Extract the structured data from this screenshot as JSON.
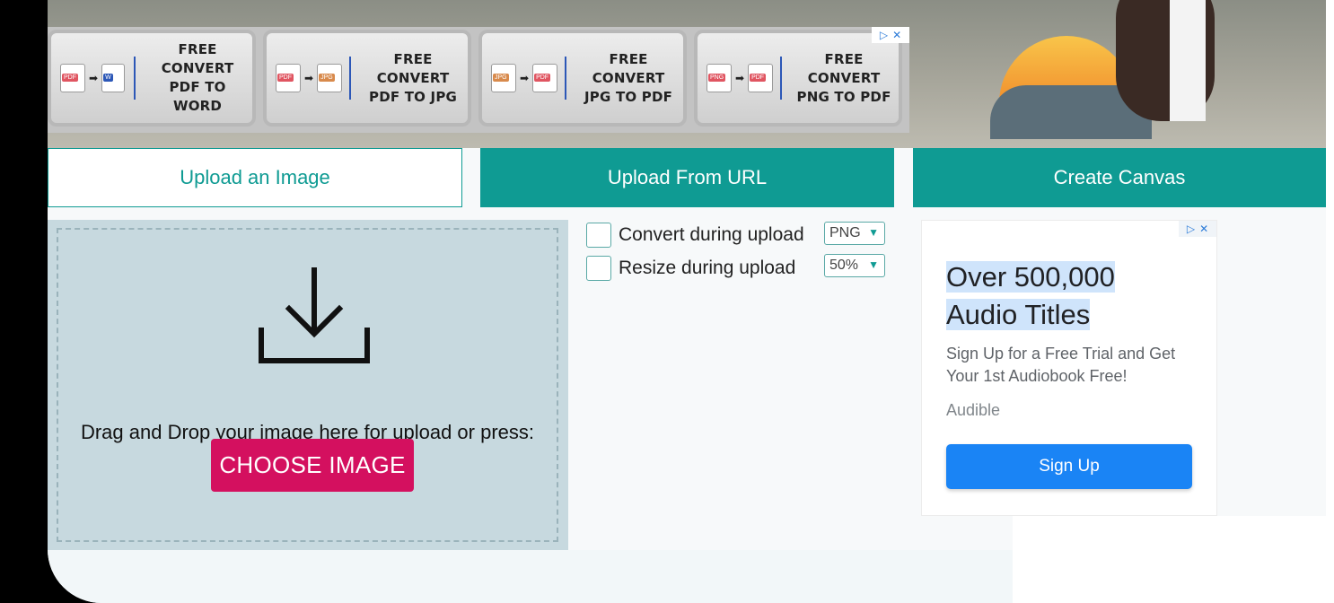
{
  "ad_strip": {
    "tiles": [
      {
        "line1": "FREE CONVERT",
        "line2": "PDF TO WORD",
        "from": "PDF",
        "to": "W"
      },
      {
        "line1": "FREE CONVERT",
        "line2": "PDF TO JPG",
        "from": "PDF",
        "to": "JPG"
      },
      {
        "line1": "FREE CONVERT",
        "line2": "JPG TO PDF",
        "from": "JPG",
        "to": "PDF"
      },
      {
        "line1": "FREE CONVERT",
        "line2": "PNG TO PDF",
        "from": "PNG",
        "to": "PDF"
      }
    ],
    "adchoices_icon": "adchoices-icon",
    "close_icon": "close-icon"
  },
  "tabs": {
    "upload": "Upload an Image",
    "url": "Upload From URL",
    "canvas": "Create Canvas"
  },
  "dropzone": {
    "text": "Drag and Drop your image here for upload or press:",
    "button": "CHOOSE IMAGE",
    "icon": "download-icon"
  },
  "options": {
    "convert_label": "Convert during upload",
    "convert_value": "PNG",
    "resize_label": "Resize during upload",
    "resize_value": "50%"
  },
  "side_ad": {
    "title_line1": "Over 500,000",
    "title_line2": "Audio Titles",
    "subtitle": "Sign Up for a Free Trial and Get Your 1st Audiobook Free!",
    "brand": "Audible",
    "cta": "Sign Up"
  },
  "colors": {
    "teal": "#0f9b93",
    "choose_button": "#d4105f",
    "signup_button": "#1a84f5",
    "dropzone_bg": "#c7d9df"
  }
}
